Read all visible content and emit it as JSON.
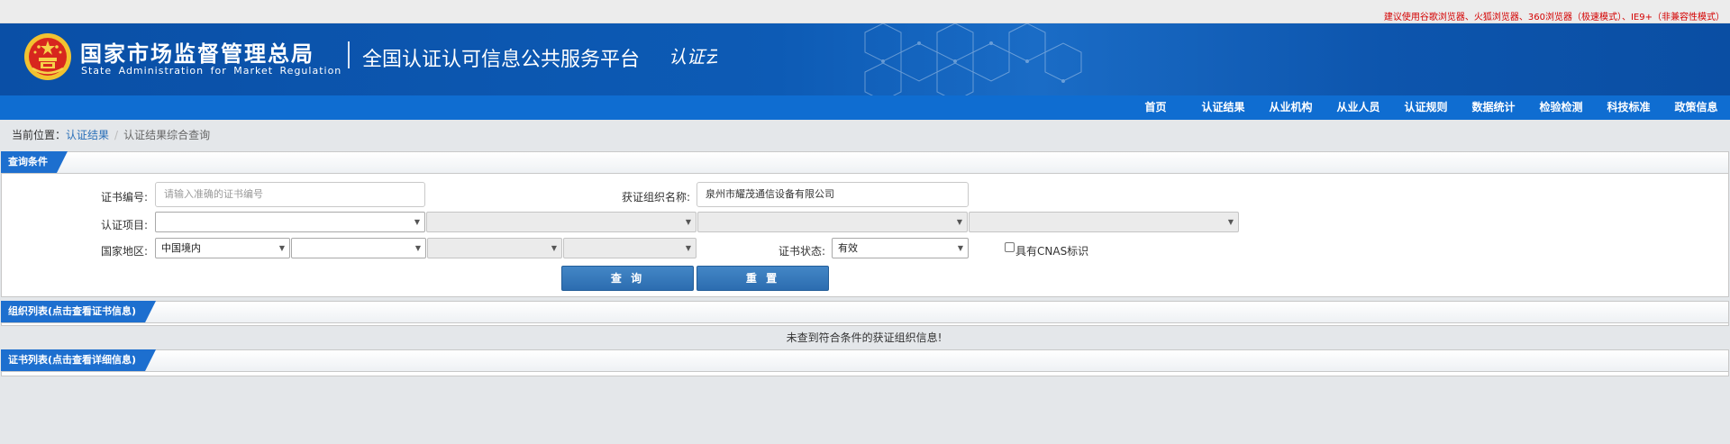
{
  "topbar": {
    "notice": "建议使用谷歌浏览器、火狐浏览器、360浏览器（极速模式）、IE9+（非兼容性模式）"
  },
  "header": {
    "title_zh": "国家市场监督管理总局",
    "title_en": "State Administration  for  Market Regulation",
    "platform_name": "全国认证认可信息公共服务平台",
    "logo_text": "认证云"
  },
  "nav": {
    "items": [
      "首页",
      "认证结果",
      "从业机构",
      "从业人员",
      "认证规则",
      "数据统计",
      "检验检测",
      "科技标准",
      "政策信息"
    ]
  },
  "breadcrumb": {
    "prefix": "当前位置：",
    "link": "认证结果",
    "separator": "/",
    "current": "认证结果综合查询"
  },
  "query_panel": {
    "title": "查询条件",
    "cert_no_label": "证书编号:",
    "cert_no_placeholder": "请输入准确的证书编号",
    "org_name_label": "获证组织名称:",
    "org_name_value": "泉州市耀茂通信设备有限公司",
    "project_label": "认证项目:",
    "region_label": "国家地区:",
    "region_value": "中国境内",
    "status_label": "证书状态:",
    "status_value": "有效",
    "cnas_label": "具有CNAS标识",
    "query_button": "查 询",
    "reset_button": "重 置"
  },
  "org_panel": {
    "title": "组织列表(点击查看证书信息)",
    "empty_message": "未查到符合条件的获证组织信息!"
  },
  "cert_panel": {
    "title": "证书列表(点击查看详细信息)"
  },
  "colors": {
    "header_blue": "#0d5bb5",
    "nav_blue": "#0f6dd1",
    "tab_blue": "#1d6fcf",
    "button_blue": "#3574b8",
    "notice_red": "#d40000"
  }
}
